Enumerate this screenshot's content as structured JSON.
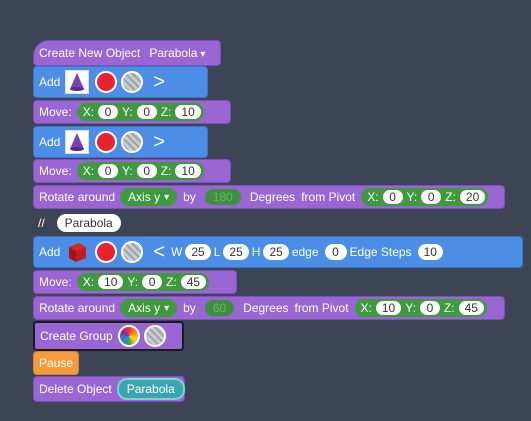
{
  "blocks": {
    "create_new": {
      "label": "Create New Object",
      "type": "Parabola"
    },
    "add1": {
      "label": "Add",
      "chevron": ">"
    },
    "move1": {
      "label": "Move:",
      "x_label": "X:",
      "x": "0",
      "y_label": "Y:",
      "y": "0",
      "z_label": "Z:",
      "z": "10"
    },
    "add2": {
      "label": "Add",
      "chevron": ">"
    },
    "move2": {
      "label": "Move:",
      "x_label": "X:",
      "x": "0",
      "y_label": "Y:",
      "y": "0",
      "z_label": "Z:",
      "z": "10"
    },
    "rotate1": {
      "label": "Rotate around",
      "axis": "Axis y",
      "by": "by",
      "degrees_value": "180",
      "degrees": "Degrees",
      "from_pivot": "from Pivot",
      "x_label": "X:",
      "x": "0",
      "y_label": "Y:",
      "y": "0",
      "z_label": "Z:",
      "z": "20"
    },
    "comment": {
      "prefix": "//",
      "text": "Parabola"
    },
    "add3": {
      "label": "Add",
      "chevron": "<",
      "w_label": "W",
      "w": "25",
      "l_label": "L",
      "l": "25",
      "h_label": "H",
      "h": "25",
      "edge_label": "edge",
      "edge": "0",
      "edge_steps_label": "Edge Steps",
      "edge_steps": "10"
    },
    "move3": {
      "label": "Move:",
      "x_label": "X:",
      "x": "10",
      "y_label": "Y:",
      "y": "0",
      "z_label": "Z:",
      "z": "45"
    },
    "rotate2": {
      "label": "Rotate around",
      "axis": "Axis y",
      "by": "by",
      "degrees_value": "60",
      "degrees": "Degrees",
      "from_pivot": "from Pivot",
      "x_label": "X:",
      "x": "10",
      "y_label": "Y:",
      "y": "0",
      "z_label": "Z:",
      "z": "45"
    },
    "create_group": {
      "label": "Create Group"
    },
    "pause": {
      "label": "Pause"
    },
    "delete": {
      "label": "Delete Object",
      "target": "Parabola"
    }
  },
  "icons": {
    "cone": "cone-shape-icon",
    "cube": "cube-shape-icon",
    "color": "red-color-swatch",
    "material": "material-swatch",
    "rainbow": "rainbow-color-swatch"
  },
  "colors": {
    "background": "#3d4455",
    "purple": "#9966d4",
    "blue": "#4c8ee6",
    "orange": "#f39c3e",
    "green": "#3f9a3f",
    "red": "#e8232f",
    "teal": "#3aa5b0"
  }
}
